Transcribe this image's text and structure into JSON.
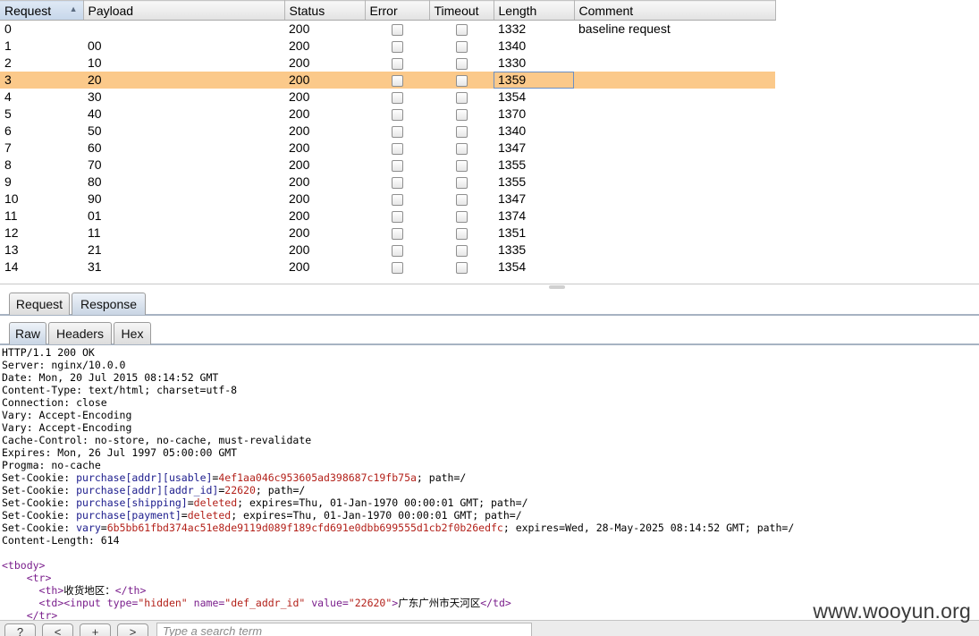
{
  "results": {
    "columns": [
      "Request",
      "Payload",
      "Status",
      "Error",
      "Timeout",
      "Length",
      "Comment"
    ],
    "sorted_column": "Request",
    "selected_request": "3",
    "rows": [
      {
        "request": "0",
        "payload": "",
        "status": "200",
        "error": false,
        "timeout": false,
        "length": "1332",
        "comment": "baseline request"
      },
      {
        "request": "1",
        "payload": "00",
        "status": "200",
        "error": false,
        "timeout": false,
        "length": "1340",
        "comment": ""
      },
      {
        "request": "2",
        "payload": "10",
        "status": "200",
        "error": false,
        "timeout": false,
        "length": "1330",
        "comment": ""
      },
      {
        "request": "3",
        "payload": "20",
        "status": "200",
        "error": false,
        "timeout": false,
        "length": "1359",
        "comment": ""
      },
      {
        "request": "4",
        "payload": "30",
        "status": "200",
        "error": false,
        "timeout": false,
        "length": "1354",
        "comment": ""
      },
      {
        "request": "5",
        "payload": "40",
        "status": "200",
        "error": false,
        "timeout": false,
        "length": "1370",
        "comment": ""
      },
      {
        "request": "6",
        "payload": "50",
        "status": "200",
        "error": false,
        "timeout": false,
        "length": "1340",
        "comment": ""
      },
      {
        "request": "7",
        "payload": "60",
        "status": "200",
        "error": false,
        "timeout": false,
        "length": "1347",
        "comment": ""
      },
      {
        "request": "8",
        "payload": "70",
        "status": "200",
        "error": false,
        "timeout": false,
        "length": "1355",
        "comment": ""
      },
      {
        "request": "9",
        "payload": "80",
        "status": "200",
        "error": false,
        "timeout": false,
        "length": "1355",
        "comment": ""
      },
      {
        "request": "10",
        "payload": "90",
        "status": "200",
        "error": false,
        "timeout": false,
        "length": "1347",
        "comment": ""
      },
      {
        "request": "11",
        "payload": "01",
        "status": "200",
        "error": false,
        "timeout": false,
        "length": "1374",
        "comment": ""
      },
      {
        "request": "12",
        "payload": "11",
        "status": "200",
        "error": false,
        "timeout": false,
        "length": "1351",
        "comment": ""
      },
      {
        "request": "13",
        "payload": "21",
        "status": "200",
        "error": false,
        "timeout": false,
        "length": "1335",
        "comment": ""
      },
      {
        "request": "14",
        "payload": "31",
        "status": "200",
        "error": false,
        "timeout": false,
        "length": "1354",
        "comment": ""
      }
    ]
  },
  "message_tabs": [
    "Request",
    "Response"
  ],
  "active_message_tab": "Response",
  "view_tabs": [
    "Raw",
    "Headers",
    "Hex"
  ],
  "active_view_tab": "Raw",
  "response": {
    "headers": [
      "HTTP/1.1 200 OK",
      "Server: nginx/10.0.0",
      "Date: Mon, 20 Jul 2015 08:14:52 GMT",
      "Content-Type: text/html; charset=utf-8",
      "Connection: close",
      "Vary: Accept-Encoding",
      "Vary: Accept-Encoding",
      "Cache-Control: no-store, no-cache, must-revalidate",
      "Expires: Mon, 26 Jul 1997 05:00:00 GMT",
      "Progma: no-cache"
    ],
    "cookies": [
      {
        "prefix": "Set-Cookie: ",
        "name": "purchase[addr][usable]",
        "eq": "=",
        "value": "4ef1aa046c953605ad398687c19fb75a",
        "rest": "; path=/"
      },
      {
        "prefix": "Set-Cookie: ",
        "name": "purchase[addr][addr_id]",
        "eq": "=",
        "value": "22620",
        "rest": "; path=/"
      },
      {
        "prefix": "Set-Cookie: ",
        "name": "purchase[shipping]",
        "eq": "=",
        "value": "deleted",
        "rest": "; expires=Thu, 01-Jan-1970 00:00:01 GMT; path=/"
      },
      {
        "prefix": "Set-Cookie: ",
        "name": "purchase[payment]",
        "eq": "=",
        "value": "deleted",
        "rest": "; expires=Thu, 01-Jan-1970 00:00:01 GMT; path=/"
      },
      {
        "prefix": "Set-Cookie: ",
        "name": "vary",
        "eq": "=",
        "value": "6b5bb61fbd374ac51e8de9119d089f189cfd691e0dbb699555d1cb2f0b26edfc",
        "rest": "; expires=Wed, 28-May-2025 08:14:52 GMT; path=/"
      }
    ],
    "content_length": "Content-Length: 614",
    "body": {
      "tbody_open": "<tbody>",
      "tr_open": "<tr>",
      "th_open": "<th>",
      "th_text": "收货地区：",
      "th_close": "</th>",
      "td_open": "<td>",
      "input_open": "<input ",
      "attr_type": "type=",
      "val_type": "\"hidden\"",
      "attr_name": "name=",
      "val_name": "\"def_addr_id\"",
      "attr_value": "value=",
      "val_value": "\"22620\"",
      "input_close": ">",
      "td_text": "广东广州市天河区",
      "td_close": "</td>",
      "tr_close": "</tr>"
    }
  },
  "bottom": {
    "help_label": "?",
    "prev_label": "<",
    "add_label": "+",
    "next_label": ">",
    "search_placeholder": "Type a search term"
  },
  "watermark": "www.wooyun.org"
}
